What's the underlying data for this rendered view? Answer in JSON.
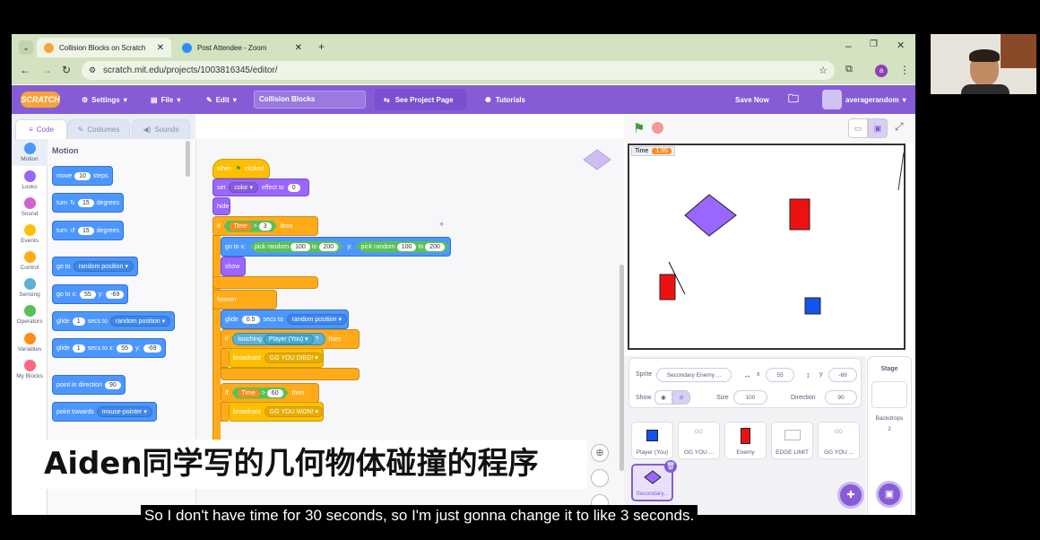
{
  "browser": {
    "tabs": [
      {
        "label": "Collision Blocks on Scratch"
      },
      {
        "label": "Post Attendee - Zoom"
      }
    ],
    "url": "scratch.mit.edu/projects/1003816345/editor/",
    "profile_initial": "a"
  },
  "scratch_menu": {
    "logo": "SCRATCH",
    "settings": "Settings",
    "file": "File",
    "edit": "Edit",
    "project_title": "Collision Blocks",
    "see_project_page": "See Project Page",
    "tutorials": "Tutorials",
    "save_now": "Save Now",
    "username": "averagerandom"
  },
  "editor_tabs": [
    "Code",
    "Costumes",
    "Sounds"
  ],
  "categories": [
    {
      "label": "Motion",
      "color": "#4c97ff"
    },
    {
      "label": "Looks",
      "color": "#9966ff"
    },
    {
      "label": "Sound",
      "color": "#cf63cf"
    },
    {
      "label": "Events",
      "color": "#ffbf00"
    },
    {
      "label": "Control",
      "color": "#ffab19"
    },
    {
      "label": "Sensing",
      "color": "#5cb1d6"
    },
    {
      "label": "Operators",
      "color": "#59c059"
    },
    {
      "label": "Variables",
      "color": "#ff8c1a"
    },
    {
      "label": "My Blocks",
      "color": "#ff6680"
    }
  ],
  "palette": {
    "heading": "Motion",
    "move": {
      "pre": "move",
      "val": "10",
      "post": "steps"
    },
    "turn_right": {
      "pre": "turn",
      "val": "15",
      "post": "degrees"
    },
    "turn_left": {
      "pre": "turn",
      "val": "15",
      "post": "degrees"
    },
    "go_to": {
      "pre": "go to",
      "dd": "random position"
    },
    "go_to_xy": {
      "pre": "go to x:",
      "x": "55",
      "y_label": "y:",
      "y": "-69"
    },
    "glide_to": {
      "pre": "glide",
      "val": "1",
      "mid": "secs to",
      "dd": "random position"
    },
    "glide_xy": {
      "pre": "glide",
      "val": "1",
      "mid": "secs to x:",
      "x": "55",
      "y_label": "y:",
      "y": "-69"
    },
    "point_direction": {
      "pre": "point in direction",
      "val": "90"
    },
    "point_towards": {
      "pre": "point towards",
      "dd": "mouse-pointer"
    }
  },
  "script": {
    "when": "when",
    "clicked": "clicked",
    "set": "set",
    "color_dd": "color",
    "effect_to": "effect to",
    "effect_val": "0",
    "hide": "hide",
    "if": "if",
    "time_var": "Time",
    "gt": ">",
    "time_val1": "3",
    "then": "then",
    "goto_xy": "go to x:",
    "pick_random": "pick random",
    "r1a": "100",
    "to": "to",
    "r1b": "200",
    "y_label": "y:",
    "r2a": "100",
    "r2b": "200",
    "show": "show",
    "forever": "forever",
    "glide": "glide",
    "glide_val": "0.5",
    "secs_to": "secs to",
    "random_position": "random position",
    "touching": "touching",
    "touch_target": "Player (You)",
    "q": "?",
    "broadcast": "broadcast",
    "msg_died": "GG YOU DIED!",
    "time_val2": "60",
    "msg_won": "GG YOU WON!"
  },
  "stage": {
    "monitor_label": "Time",
    "monitor_value": "1.95"
  },
  "sprite_info": {
    "sprite_label": "Sprite",
    "sprite_name": "Secondary Enemy ...",
    "x_label": "x",
    "x": "55",
    "y_label": "y",
    "y": "-69",
    "show_label": "Show",
    "size_label": "Size",
    "size": "100",
    "direction_label": "Direction",
    "direction": "90"
  },
  "sprites": [
    {
      "label": "Player (You)"
    },
    {
      "label": "GG YOU ..."
    },
    {
      "label": "Enemy"
    },
    {
      "label": "EDGE LIMIT"
    },
    {
      "label": "GG YOU ..."
    },
    {
      "label": "Secondary..."
    }
  ],
  "stage_panel": {
    "title": "Stage",
    "backdrops_label": "Backdrops",
    "backdrops_count": "2"
  },
  "overlay_title": "Aiden同学写的几何物体碰撞的程序",
  "subtitle": "So I don't have time for 30 seconds, so I'm just gonna change it to like 3 seconds."
}
